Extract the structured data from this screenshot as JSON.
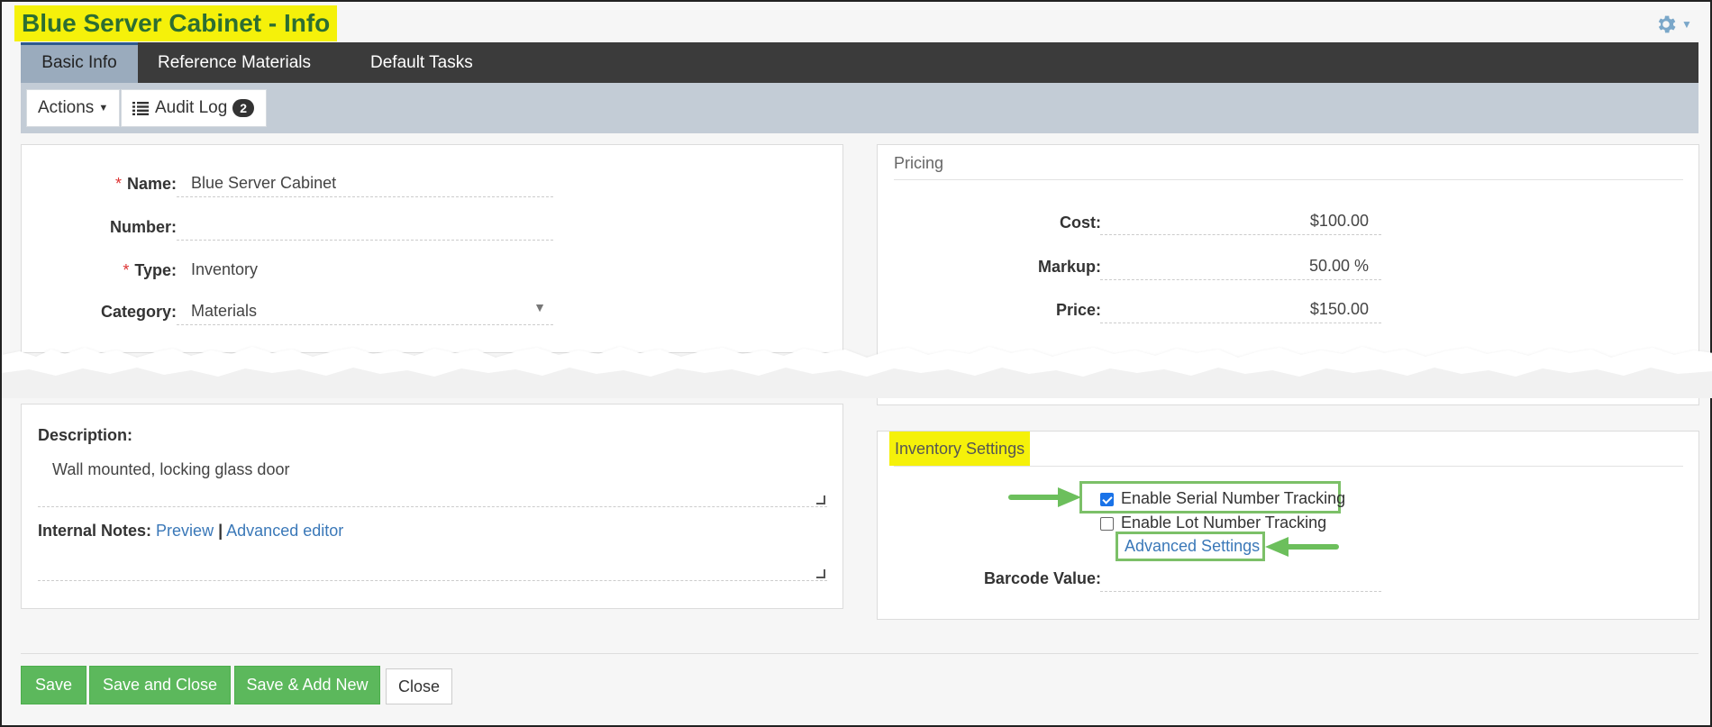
{
  "page": {
    "title": "Blue Server Cabinet - Info"
  },
  "tabs": [
    {
      "label": "Basic Info",
      "active": true
    },
    {
      "label": "Reference Materials",
      "active": false
    },
    {
      "label": "Default Tasks",
      "active": false
    }
  ],
  "toolbar": {
    "actions_label": "Actions",
    "audit_log_label": "Audit Log",
    "audit_log_count": "2"
  },
  "basic": {
    "name_label": "Name:",
    "name_value": "Blue Server Cabinet",
    "number_label": "Number:",
    "number_value": "",
    "type_label": "Type:",
    "type_value": "Inventory",
    "category_label": "Category:",
    "category_value": "Materials",
    "required_mark": "*"
  },
  "pricing": {
    "title": "Pricing",
    "cost_label": "Cost:",
    "cost_value": "$100.00",
    "markup_label": "Markup:",
    "markup_value": "50.00 %",
    "price_label": "Price:",
    "price_value": "$150.00"
  },
  "description": {
    "label": "Description:",
    "value": "Wall mounted, locking glass door",
    "internal_notes_label": "Internal Notes:",
    "preview_link": "Preview",
    "separator": "|",
    "advanced_editor_link": "Advanced editor"
  },
  "inventory": {
    "title": "Inventory Settings",
    "serial_label": "Enable Serial Number Tracking",
    "serial_checked": true,
    "lot_label": "Enable Lot Number Tracking",
    "lot_checked": false,
    "advanced_settings_link": "Advanced Settings",
    "barcode_label": "Barcode Value:",
    "barcode_value": ""
  },
  "footer": {
    "save": "Save",
    "save_close": "Save and Close",
    "save_add_new": "Save & Add New",
    "close": "Close"
  },
  "colors": {
    "title_highlight": "#f5f10a",
    "title_text": "#2c6e32",
    "tabbar": "#3b3b3b",
    "toolbar": "#c3ccd6",
    "button_green": "#5cb85c",
    "link": "#3a78b8",
    "annotation_green": "#7cc068"
  },
  "icons": {
    "settings": "gear-icon",
    "audit_log": "list-icon",
    "dropdown": "caret-down-icon"
  }
}
